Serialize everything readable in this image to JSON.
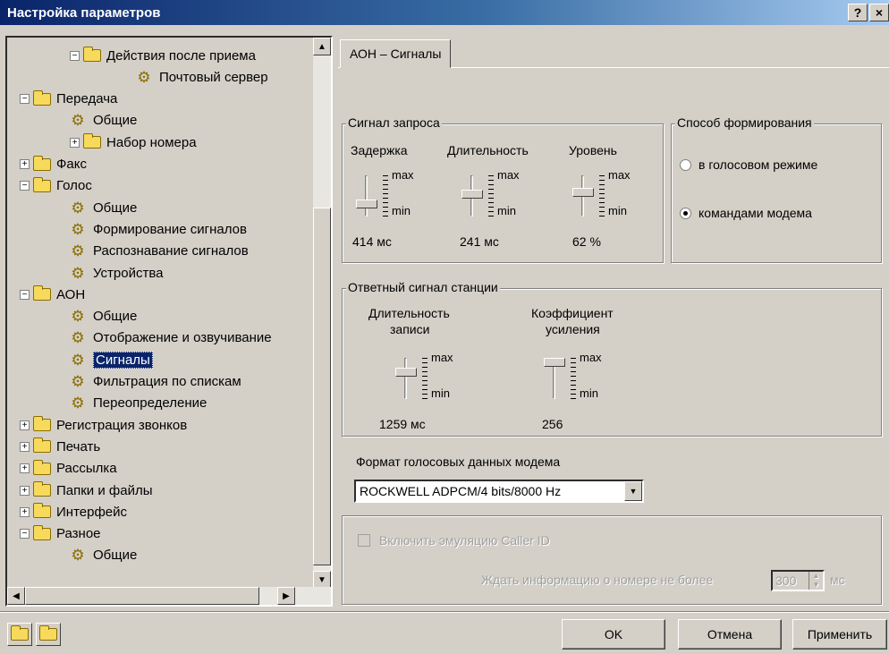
{
  "window": {
    "title": "Настройка параметров",
    "help_label": "?",
    "close_label": "×"
  },
  "tree": {
    "items": [
      {
        "label": "Действия после приема",
        "type": "folder",
        "expander": "−"
      },
      {
        "label": "Почтовый сервер",
        "type": "gear"
      },
      {
        "label": "Передача",
        "type": "folder",
        "expander": "−"
      },
      {
        "label": "Общие",
        "type": "gear"
      },
      {
        "label": "Набор номера",
        "type": "folder",
        "expander": "+"
      },
      {
        "label": "Факс",
        "type": "folder",
        "expander": "+"
      },
      {
        "label": "Голос",
        "type": "folder",
        "expander": "−"
      },
      {
        "label": "Общие",
        "type": "gear"
      },
      {
        "label": "Формирование сигналов",
        "type": "gear"
      },
      {
        "label": "Распознавание сигналов",
        "type": "gear"
      },
      {
        "label": "Устройства",
        "type": "gear"
      },
      {
        "label": "АОН",
        "type": "folder",
        "expander": "−"
      },
      {
        "label": "Общие",
        "type": "gear"
      },
      {
        "label": "Отображение и озвучивание",
        "type": "gear"
      },
      {
        "label": "Сигналы",
        "type": "gear",
        "selected": true
      },
      {
        "label": "Фильтрация по спискам",
        "type": "gear"
      },
      {
        "label": "Переопределение",
        "type": "gear"
      },
      {
        "label": "Регистрация звонков",
        "type": "folder",
        "expander": "+"
      },
      {
        "label": "Печать",
        "type": "folder",
        "expander": "+"
      },
      {
        "label": "Рассылка",
        "type": "folder",
        "expander": "+"
      },
      {
        "label": "Папки и файлы",
        "type": "folder",
        "expander": "+"
      },
      {
        "label": "Интерфейс",
        "type": "folder",
        "expander": "+"
      },
      {
        "label": "Разное",
        "type": "folder",
        "expander": "−"
      },
      {
        "label": "Общие",
        "type": "gear"
      }
    ]
  },
  "tab": {
    "label": "АОН – Сигналы"
  },
  "request_signal": {
    "legend": "Сигнал запроса",
    "delay": {
      "label": "Задержка",
      "value": "414 мс",
      "max": "max",
      "min": "min",
      "level": 0.25
    },
    "duration": {
      "label": "Длительность",
      "value": "241 мс",
      "max": "max",
      "min": "min",
      "level": 0.55
    },
    "level": {
      "label": "Уровень",
      "value": "62 %",
      "max": "max",
      "min": "min",
      "level": 0.62
    }
  },
  "formation": {
    "legend": "Способ формирования",
    "option_voice": "в голосовом режиме",
    "option_modem": "командами модема",
    "selected": "option_modem"
  },
  "station_response": {
    "legend": "Ответный сигнал станции",
    "record_duration": {
      "label_line1": "Длительность",
      "label_line2": "записи",
      "value": "1259 мс",
      "max": "max",
      "min": "min",
      "level": 0.7
    },
    "gain": {
      "label_line1": "Коэффициент",
      "label_line2": "усиления",
      "value": "256",
      "max": "max",
      "min": "min",
      "level": 1.0
    }
  },
  "voice_format": {
    "label": "Формат голосовых данных модема",
    "value": "ROCKWELL ADPCM/4 bits/8000 Hz"
  },
  "caller_id": {
    "checkbox_label": "Включить эмуляцию Caller ID",
    "wait_label": "Ждать информацию о номере не более",
    "wait_value": "300",
    "wait_unit": "мс"
  },
  "buttons": {
    "ok": "OK",
    "cancel": "Отмена",
    "apply": "Применить"
  }
}
